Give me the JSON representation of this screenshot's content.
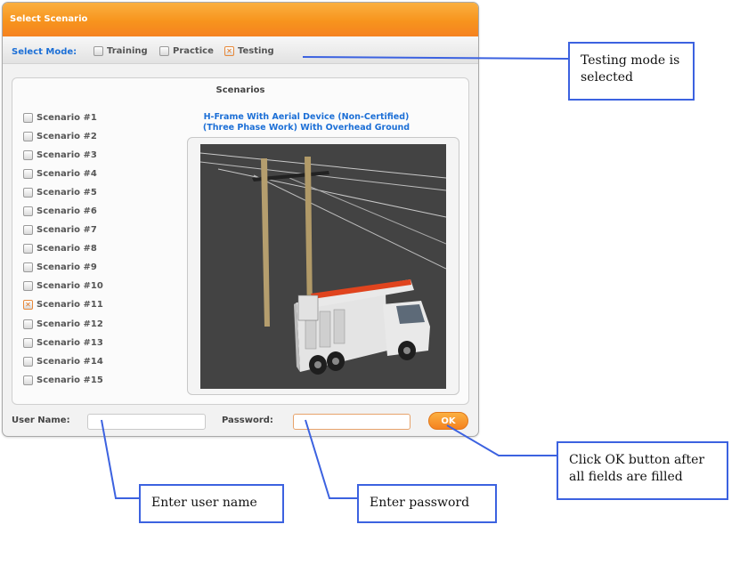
{
  "window": {
    "title": "Select Scenario",
    "accent_color": "#f7941d",
    "link_color": "#1c6fd6"
  },
  "mode_bar": {
    "label": "Select Mode:",
    "options": [
      {
        "label": "Training",
        "checked": false
      },
      {
        "label": "Practice",
        "checked": false
      },
      {
        "label": "Testing",
        "checked": true
      }
    ]
  },
  "scenarios": {
    "title": "Scenarios",
    "items": [
      {
        "label": "Scenario #1",
        "checked": false
      },
      {
        "label": "Scenario #2",
        "checked": false
      },
      {
        "label": "Scenario #3",
        "checked": false
      },
      {
        "label": "Scenario #4",
        "checked": false
      },
      {
        "label": "Scenario #5",
        "checked": false
      },
      {
        "label": "Scenario #6",
        "checked": false
      },
      {
        "label": "Scenario #7",
        "checked": false
      },
      {
        "label": "Scenario #8",
        "checked": false
      },
      {
        "label": "Scenario #9",
        "checked": false
      },
      {
        "label": "Scenario #10",
        "checked": false
      },
      {
        "label": "Scenario #11",
        "checked": true
      },
      {
        "label": "Scenario #12",
        "checked": false
      },
      {
        "label": "Scenario #13",
        "checked": false
      },
      {
        "label": "Scenario #14",
        "checked": false
      },
      {
        "label": "Scenario #15",
        "checked": false
      }
    ],
    "selected_name": "H-Frame With Aerial Device (Non-Certified) (Three Phase Work) With Overhead Ground"
  },
  "login": {
    "username_label": "User Name:",
    "username_value": "",
    "password_label": "Password:",
    "password_value": "",
    "ok_label": "OK"
  },
  "callouts": {
    "testing_mode": "Testing mode is selected",
    "ok_button": "Click OK button after all fields are filled",
    "user_name": "Enter user name",
    "password": "Enter password"
  }
}
